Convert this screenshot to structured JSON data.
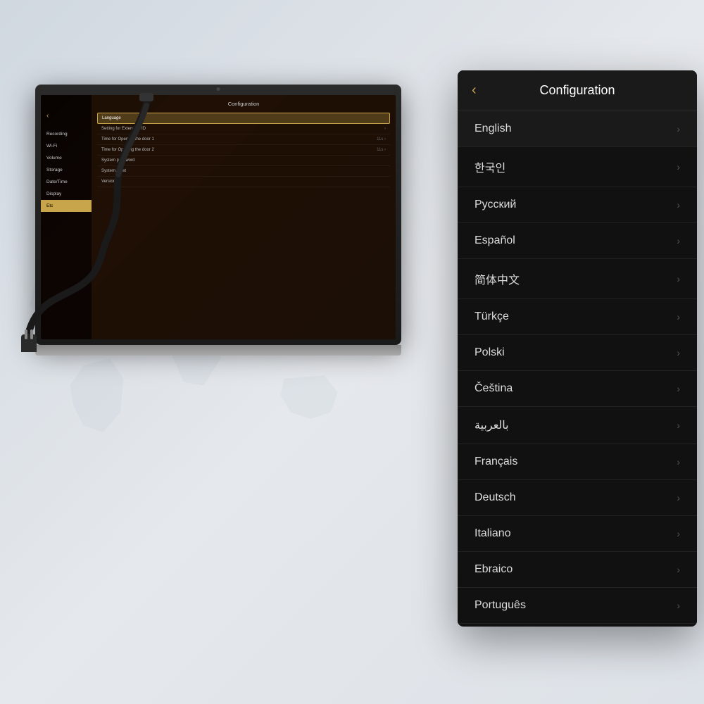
{
  "background": {
    "color": "#e0e4e8"
  },
  "device": {
    "camera_alt": "camera dot"
  },
  "screen": {
    "back_label": "‹",
    "config_title": "Configuration",
    "sidebar_items": [
      {
        "label": "Recording",
        "active": false
      },
      {
        "label": "Wi-Fi",
        "active": false
      },
      {
        "label": "Volume",
        "active": false
      },
      {
        "label": "Storage",
        "active": false
      },
      {
        "label": "Date/Time",
        "active": false
      },
      {
        "label": "Display",
        "active": false
      },
      {
        "label": "Etc",
        "active": true
      }
    ],
    "config_items": [
      {
        "label": "Language",
        "highlighted": true,
        "has_chevron": false
      },
      {
        "label": "Setting for Extension ID",
        "highlighted": false,
        "has_chevron": true
      },
      {
        "label": "Time for Opening the door 1",
        "highlighted": false,
        "has_chevron": true,
        "value": "11s"
      },
      {
        "label": "Time for Opening the door 2",
        "highlighted": false,
        "has_chevron": true,
        "value": "11s"
      },
      {
        "label": "System  password",
        "highlighted": false,
        "has_chevron": false
      },
      {
        "label": "System reset",
        "highlighted": false,
        "has_chevron": false
      },
      {
        "label": "Version",
        "highlighted": false,
        "has_chevron": false
      }
    ]
  },
  "config_panel": {
    "back_label": "‹",
    "title": "Configuration",
    "items": [
      {
        "id": "english",
        "label": "English",
        "selected": true
      },
      {
        "id": "korean",
        "label": "한국인",
        "selected": false
      },
      {
        "id": "russian",
        "label": "Русский",
        "selected": false
      },
      {
        "id": "spanish",
        "label": "Español",
        "selected": false
      },
      {
        "id": "chinese",
        "label": "简体中文",
        "selected": false
      },
      {
        "id": "turkish",
        "label": "Türkçe",
        "selected": false
      },
      {
        "id": "polish",
        "label": "Polski",
        "selected": false
      },
      {
        "id": "czech",
        "label": "Čeština",
        "selected": false
      },
      {
        "id": "arabic",
        "label": "بالعربية",
        "selected": false
      },
      {
        "id": "french",
        "label": "Français",
        "selected": false
      },
      {
        "id": "german",
        "label": "Deutsch",
        "selected": false
      },
      {
        "id": "italian",
        "label": "Italiano",
        "selected": false
      },
      {
        "id": "hebrew",
        "label": "Ebraico",
        "selected": false
      },
      {
        "id": "portuguese",
        "label": "Português",
        "selected": false
      }
    ]
  }
}
